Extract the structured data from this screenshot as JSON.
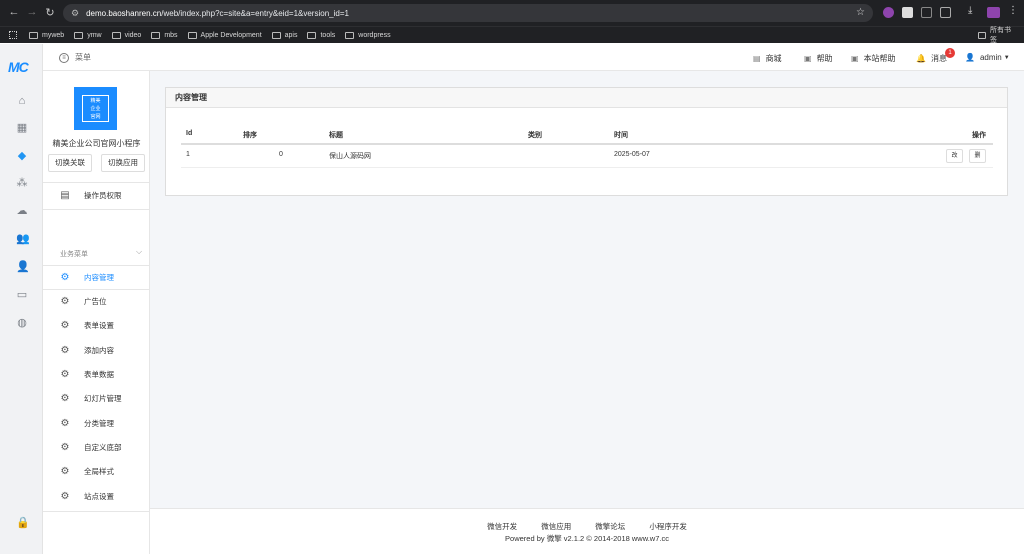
{
  "browser": {
    "url_host": "demo.baoshanren.cn",
    "url_path": "/web/index.php?c=site&a=entry&eid=1&version_id=1",
    "bookmarks": [
      "myweb",
      "ymw",
      "video",
      "mbs",
      "Apple Development",
      "apis",
      "tools",
      "wordpress"
    ],
    "all_bookmarks": "所有书签"
  },
  "app": {
    "logo": "MC",
    "menu_label": "菜单",
    "top_nav": [
      "商城",
      "帮助",
      "本站帮助",
      "消息",
      "admin"
    ],
    "message_count": "1"
  },
  "sidebar": {
    "logo_text": [
      "精美",
      "企业",
      "官网"
    ],
    "site_name": "精美企业公司官网小程序",
    "switch_link": "切换关联",
    "switch_app": "切换应用",
    "operator_permission": "操作员权限",
    "section_title": "业务菜单",
    "items": [
      "内容管理",
      "广告位",
      "表单设置",
      "添加内容",
      "表单数据",
      "幻灯片管理",
      "分类管理",
      "自定义底部",
      "全局样式",
      "站点设置"
    ],
    "active_index": 0
  },
  "content": {
    "panel_title": "内容管理",
    "headers": [
      "Id",
      "排序",
      "标题",
      "类别",
      "时间",
      "操作"
    ],
    "rows": [
      {
        "id": "1",
        "order": "0",
        "title": "保山人源码网",
        "category": "",
        "time": "2025-05-07",
        "edit": "改",
        "delete": "删"
      }
    ]
  },
  "footer": {
    "links": [
      "微信开发",
      "微信应用",
      "微擎论坛",
      "小程序开发"
    ],
    "copyright": "Powered by 微擎 v2.1.2 © 2014-2018 www.w7.cc"
  },
  "colors": {
    "accent": "#1b8cff",
    "badge": "#e53935"
  }
}
